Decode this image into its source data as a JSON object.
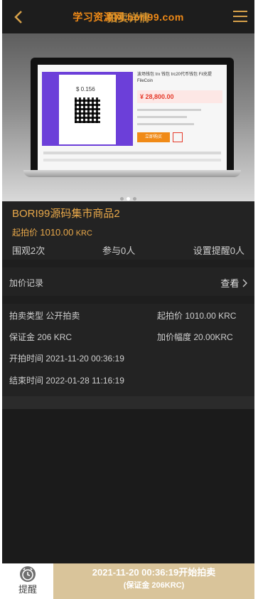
{
  "header": {
    "title": "拍卖详情",
    "watermark": "学习资源网.bori99.com",
    "back_icon": "chevron-left-icon",
    "menu_icon": "hamburger-menu-icon"
  },
  "hero": {
    "screen_title": "波场钱包 trx 钱包 trc20代币钱包 Fil充提 FileCoin",
    "screen_price": "¥ 28,800.00",
    "screen_amount": "$ 0.156",
    "screen_buy": "立即购买",
    "slide_count": 3,
    "active_slide": 1
  },
  "product": {
    "name": "BORI99源码集市商品2",
    "start_price_label": "起拍价",
    "start_price_value": "1010.00",
    "start_price_unit": "KRC",
    "views": "围观2次",
    "participants": "参与0人",
    "reminders": "设置提醒0人"
  },
  "records": {
    "label": "加价记录",
    "view_label": "查看"
  },
  "details": {
    "type_label": "拍卖类型",
    "type_value": "公开拍卖",
    "start_label": "起拍价",
    "start_value": "1010.00 KRC",
    "deposit_label": "保证金",
    "deposit_value": "206 KRC",
    "increment_label": "加价幅度",
    "increment_value": "20.00KRC",
    "open_time_label": "开拍时间",
    "open_time_value": "2021-11-20 00:36:19",
    "end_time_label": "结束时间",
    "end_time_value": "2022-01-28 11:16:19"
  },
  "bottom": {
    "remind_label": "提醒",
    "remind_icon": "alarm-clock-icon",
    "start_line1": "2021-11-20 00:36:19开始拍卖",
    "start_line2": "(保证金 206KRC)"
  },
  "colors": {
    "accent": "#e8a84a",
    "watermark": "#f08a17",
    "button_bg": "#d9c49a",
    "panel": "#232323"
  }
}
